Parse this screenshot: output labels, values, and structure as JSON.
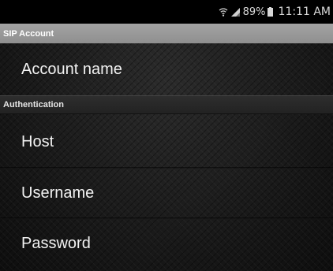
{
  "status_bar": {
    "wifi_icon": "wifi-icon",
    "signal_icon": "signal-icon",
    "battery_percent": "89%",
    "battery_icon": "battery-icon",
    "time": "11:11 AM"
  },
  "sections": {
    "sip_account": {
      "header": "SIP Account",
      "items": {
        "account_name": "Account name"
      }
    },
    "authentication": {
      "header": "Authentication",
      "items": {
        "host": "Host",
        "username": "Username",
        "password": "Password"
      }
    }
  },
  "colors": {
    "status_bar_bg": "#000000",
    "sip_header_bg": "#9a9a9a",
    "auth_header_bg": "#262626",
    "text": "#f2f2f2"
  }
}
